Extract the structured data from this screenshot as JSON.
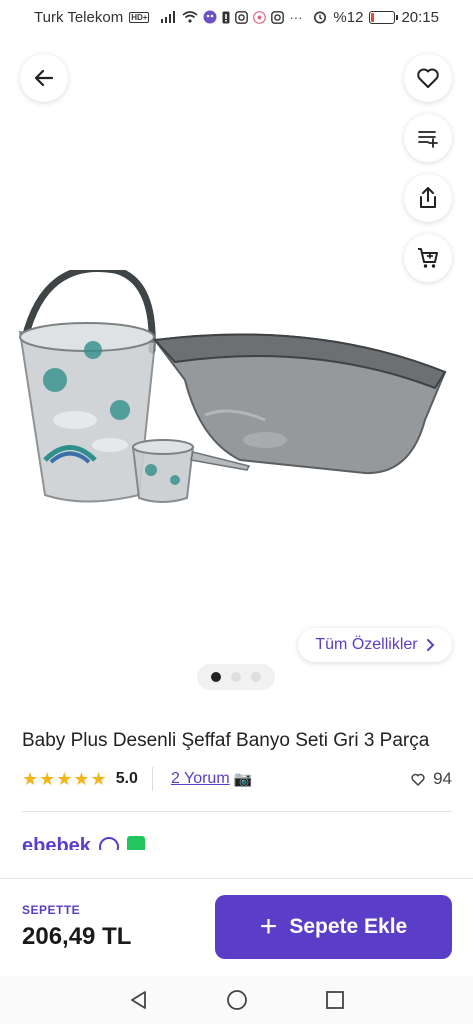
{
  "status_bar": {
    "carrier": "Turk Telekom",
    "hd_badge": "HD+",
    "battery_text": "%12",
    "battery_level": 0.12,
    "time": "20:15"
  },
  "gallery": {
    "features_label": "Tüm Özellikler",
    "slide_count": 3,
    "active_slide": 1
  },
  "product": {
    "title": "Baby Plus Desenli Şeffaf Banyo Seti Gri 3 Parça",
    "rating_value": "5.0",
    "rating_stars": 5,
    "reviews_label": "2 Yorum",
    "likes_count": "94",
    "seller_name": "ebebek"
  },
  "bottom_bar": {
    "cart_label": "SEPETTE",
    "price": "206,49 TL",
    "add_button_label": "Sepete Ekle"
  },
  "colors": {
    "accent": "#5a3ec8",
    "star": "#f2b61b",
    "battery_low": "#e34a2e"
  },
  "icons": [
    "back-arrow-icon",
    "heart-icon",
    "filter-list-icon",
    "share-icon",
    "cart-icon",
    "chevron-right-icon",
    "camera-icon",
    "info-icon",
    "plus-icon",
    "nav-back-icon",
    "nav-home-icon",
    "nav-recents-icon"
  ]
}
